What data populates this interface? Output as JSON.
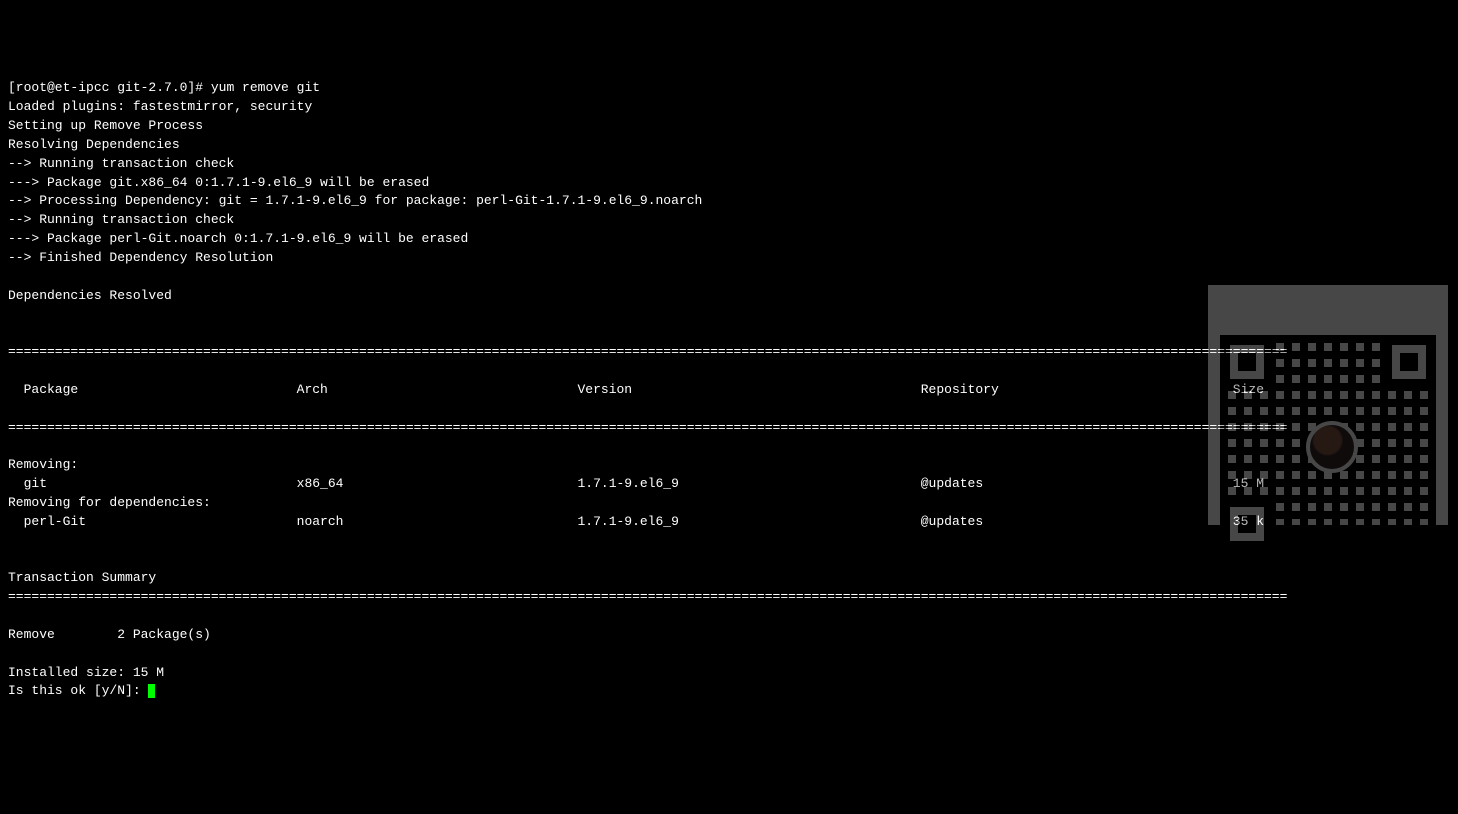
{
  "prompt": "[root@et-ipcc git-2.7.0]# ",
  "command": "yum remove git",
  "preamble": [
    "Loaded plugins: fastestmirror, security",
    "Setting up Remove Process",
    "Resolving Dependencies",
    "--> Running transaction check",
    "---> Package git.x86_64 0:1.7.1-9.el6_9 will be erased",
    "--> Processing Dependency: git = 1.7.1-9.el6_9 for package: perl-Git-1.7.1-9.el6_9.noarch",
    "--> Running transaction check",
    "---> Package perl-Git.noarch 0:1.7.1-9.el6_9 will be erased",
    "--> Finished Dependency Resolution",
    "",
    "Dependencies Resolved",
    ""
  ],
  "table": {
    "headers": {
      "package": "Package",
      "arch": "Arch",
      "version": "Version",
      "repository": "Repository",
      "size": "Size"
    },
    "sections": [
      {
        "title": "Removing:",
        "rows": [
          {
            "package": "git",
            "arch": "x86_64",
            "version": "1.7.1-9.el6_9",
            "repository": "@updates",
            "size": "15 M"
          }
        ]
      },
      {
        "title": "Removing for dependencies:",
        "rows": [
          {
            "package": "perl-Git",
            "arch": "noarch",
            "version": "1.7.1-9.el6_9",
            "repository": "@updates",
            "size": "35 k"
          }
        ]
      }
    ]
  },
  "summary": {
    "heading": "Transaction Summary",
    "line": "Remove        2 Package(s)",
    "installed_size": "Installed size: 15 M",
    "confirm": "Is this ok [y/N]: "
  },
  "rule_char": "="
}
